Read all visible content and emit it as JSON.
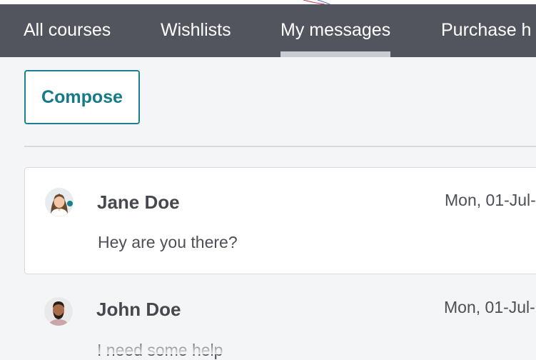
{
  "nav": {
    "tabs": [
      {
        "label": "All courses",
        "active": false
      },
      {
        "label": "Wishlists",
        "active": false
      },
      {
        "label": "My messages",
        "active": true
      },
      {
        "label": "Purchase h",
        "active": false
      }
    ]
  },
  "compose": {
    "label": "Compose"
  },
  "messages": [
    {
      "sender": "Jane Doe",
      "date": "Mon, 01-Jul-",
      "preview": "Hey are you there?",
      "avatar_icon": "female-avatar-icon",
      "selected": true
    },
    {
      "sender": "John Doe",
      "date": "Mon, 01-Jul-",
      "preview": "I need some help",
      "avatar_icon": "male-avatar-icon",
      "selected": false
    }
  ],
  "colors": {
    "nav_bg": "#52555d",
    "nav_text": "#ffffff",
    "active_underline": "#c9ccd1",
    "accent": "#1b7f8f",
    "page_bg": "#f4f5f7",
    "card_bg": "#ffffff"
  }
}
